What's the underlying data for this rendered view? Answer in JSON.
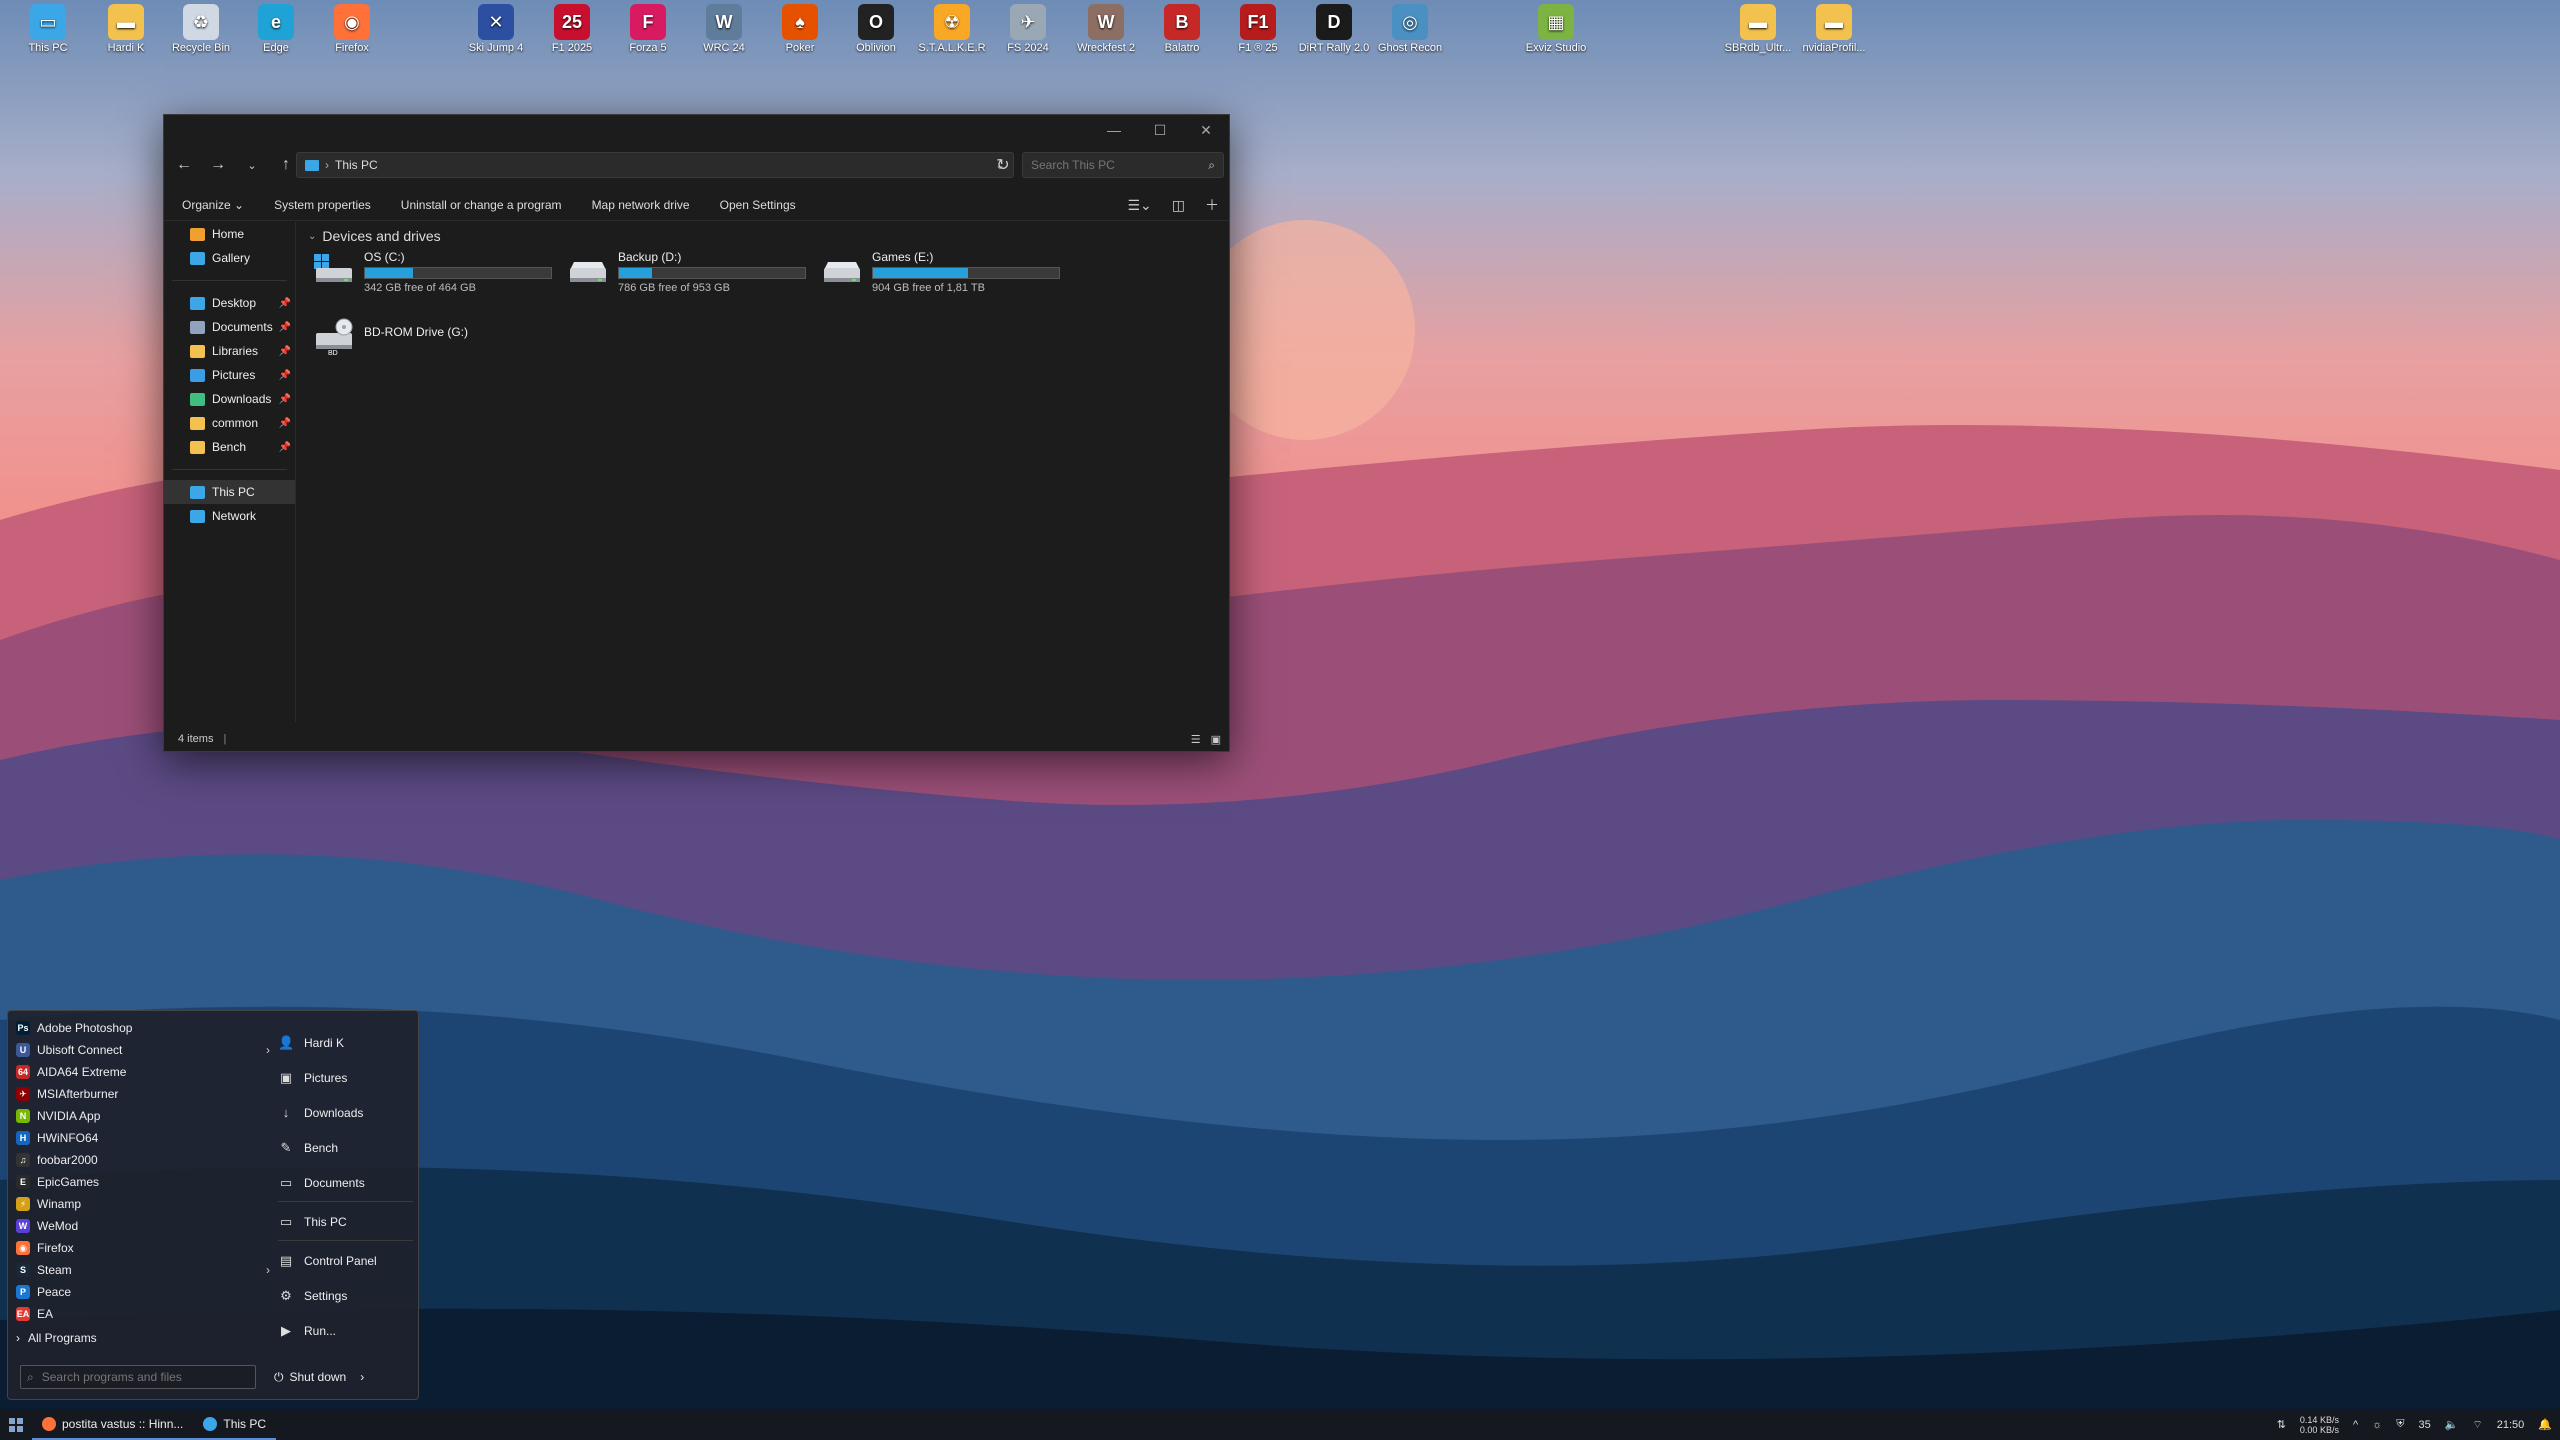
{
  "desktop_icons": [
    {
      "label": "This PC",
      "color": "#3ba7e6",
      "glyph": "▭"
    },
    {
      "label": "Hardi K",
      "color": "#f2c14e",
      "glyph": "▬"
    },
    {
      "label": "Recycle Bin",
      "color": "#cfd8e3",
      "glyph": "♻"
    },
    {
      "label": "Edge",
      "color": "#1fa2d6",
      "glyph": "e"
    },
    {
      "label": "Firefox",
      "color": "#ff7139",
      "glyph": "◉"
    },
    {
      "label": "Ski Jump 4",
      "color": "#2d4fa1",
      "glyph": "✕"
    },
    {
      "label": "F1 2025",
      "color": "#c8102e",
      "glyph": "25"
    },
    {
      "label": "Forza 5",
      "color": "#d81b60",
      "glyph": "F"
    },
    {
      "label": "WRC 24",
      "color": "#5f7c9a",
      "glyph": "W"
    },
    {
      "label": "Poker",
      "color": "#e65100",
      "glyph": "♠"
    },
    {
      "label": "Oblivion",
      "color": "#222222",
      "glyph": "O"
    },
    {
      "label": "S.T.A.L.K.E.R",
      "color": "#f9a825",
      "glyph": "☢"
    },
    {
      "label": "FS 2024",
      "color": "#9aa7b5",
      "glyph": "✈"
    },
    {
      "label": "Wreckfest 2",
      "color": "#8d6e63",
      "glyph": "W"
    },
    {
      "label": "Balatro",
      "color": "#c62828",
      "glyph": "B"
    },
    {
      "label": "F1 ® 25",
      "color": "#b71c1c",
      "glyph": "F1"
    },
    {
      "label": "DiRT Rally 2.0",
      "color": "#1b1b1b",
      "glyph": "D"
    },
    {
      "label": "Ghost Recon",
      "color": "#4a90c2",
      "glyph": "◎"
    },
    {
      "label": "Exviz Studio",
      "color": "#7cb342",
      "glyph": "▦"
    },
    {
      "label": "SBRdb_Ultr...",
      "color": "#f2c14e",
      "glyph": "▬"
    },
    {
      "label": "nvidiaProfil...",
      "color": "#f2c14e",
      "glyph": "▬"
    }
  ],
  "explorer": {
    "address": "This PC",
    "search_placeholder": "Search This PC",
    "toolbar": [
      "Organize ⌄",
      "System properties",
      "Uninstall or change a program",
      "Map network drive",
      "Open Settings"
    ],
    "sidebar": {
      "top": [
        {
          "label": "Home",
          "color": "#f0a030"
        },
        {
          "label": "Gallery",
          "color": "#3ba7e6"
        }
      ],
      "pinned": [
        {
          "label": "Desktop",
          "color": "#3ba7e6"
        },
        {
          "label": "Documents",
          "color": "#8fa3bf"
        },
        {
          "label": "Libraries",
          "color": "#f2c14e"
        },
        {
          "label": "Pictures",
          "color": "#3b9de6"
        },
        {
          "label": "Downloads",
          "color": "#3fbf7f"
        },
        {
          "label": "common",
          "color": "#f2c14e"
        },
        {
          "label": "Bench",
          "color": "#f2c14e"
        }
      ],
      "bottom": [
        {
          "label": "This PC",
          "color": "#3ba7e6"
        },
        {
          "label": "Network",
          "color": "#3ba7e6"
        }
      ]
    },
    "group_header": "Devices and drives",
    "drives": [
      {
        "name": "OS (C:)",
        "free": "342 GB free of 464 GB",
        "used_fraction": 0.26
      },
      {
        "name": "Backup (D:)",
        "free": "786 GB free of 953 GB",
        "used_fraction": 0.18
      },
      {
        "name": "Games (E:)",
        "free": "904 GB free of 1,81 TB",
        "used_fraction": 0.51
      },
      {
        "name": "BD-ROM Drive (G:)",
        "free": "",
        "used_fraction": null
      }
    ],
    "status": "4 items"
  },
  "start_menu": {
    "programs": [
      {
        "label": "Adobe Photoshop",
        "color": "#001e36",
        "glyph": "Ps"
      },
      {
        "label": "Ubisoft Connect",
        "color": "#3b5998",
        "glyph": "U",
        "submenu": true
      },
      {
        "label": "AIDA64 Extreme",
        "color": "#c62828",
        "glyph": "64"
      },
      {
        "label": "MSIAfterburner",
        "color": "#8b0000",
        "glyph": "✈"
      },
      {
        "label": "NVIDIA App",
        "color": "#76b900",
        "glyph": "N"
      },
      {
        "label": "HWiNFO64",
        "color": "#1565c0",
        "glyph": "H"
      },
      {
        "label": "foobar2000",
        "color": "#333333",
        "glyph": "♫"
      },
      {
        "label": "EpicGames",
        "color": "#2a2a2a",
        "glyph": "E"
      },
      {
        "label": "Winamp",
        "color": "#d4a017",
        "glyph": "⚡"
      },
      {
        "label": "WeMod",
        "color": "#5b3fd9",
        "glyph": "W"
      },
      {
        "label": "Firefox",
        "color": "#ff7139",
        "glyph": "◉"
      },
      {
        "label": "Steam",
        "color": "#1b2838",
        "glyph": "S",
        "submenu": true
      },
      {
        "label": "Peace",
        "color": "#1976d2",
        "glyph": "P"
      },
      {
        "label": "EA",
        "color": "#e53935",
        "glyph": "EA"
      }
    ],
    "all_programs": "All Programs",
    "search_placeholder": "Search programs and files",
    "places": [
      {
        "label": "Hardi K",
        "glyph": "👤"
      },
      {
        "label": "Pictures",
        "glyph": "▣"
      },
      {
        "label": "Downloads",
        "glyph": "↓"
      },
      {
        "label": "Bench",
        "glyph": "✎"
      },
      {
        "label": "Documents",
        "glyph": "▭",
        "sep_after": true
      },
      {
        "label": "This PC",
        "glyph": "▭",
        "sep_after": true
      },
      {
        "label": "Control Panel",
        "glyph": "▤"
      },
      {
        "label": "Settings",
        "glyph": "⚙"
      },
      {
        "label": "Run...",
        "glyph": "▶"
      }
    ],
    "shutdown": "Shut down"
  },
  "taskbar": {
    "tasks": [
      {
        "label": "postita vastus :: Hinn...",
        "color": "#ff7139"
      },
      {
        "label": "This PC",
        "color": "#3ba7e6"
      }
    ],
    "net_up": "0.14 KB/s",
    "net_down": "0.00 KB/s",
    "temp": "35",
    "clock": "21:50"
  }
}
